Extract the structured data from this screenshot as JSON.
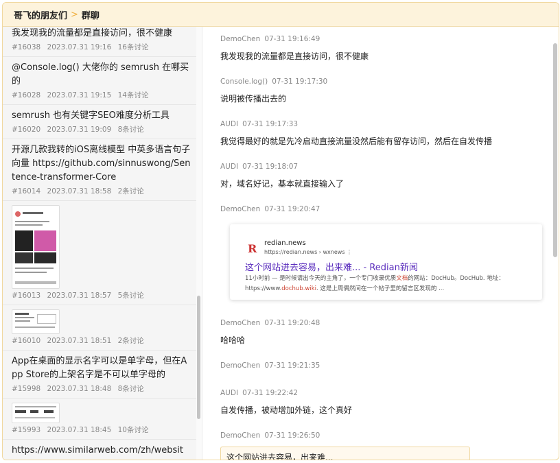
{
  "header": {
    "group": "哥飞的朋友们",
    "separator": ">",
    "current": "群聊"
  },
  "topics": [
    {
      "title": "我发现我的流量都是直接访问，很不健康",
      "id": "#16038",
      "time": "2023.07.31 19:16",
      "comments": "16条讨论"
    },
    {
      "title": "@Console.log() 大佬你的 semrush 在哪买的",
      "id": "#16028",
      "time": "2023.07.31 19:15",
      "comments": "14条讨论"
    },
    {
      "title": "semrush 也有关键字SEO难度分析工具",
      "id": "#16020",
      "time": "2023.07.31 19:09",
      "comments": "8条讨论"
    },
    {
      "title": "开源几款我转的iOS离线模型 中英多语言句子向量 https://github.com/sinnuswong/Sentence-transformer-Core",
      "id": "#16014",
      "time": "2023.07.31 18:58",
      "comments": "2条讨论"
    },
    {
      "title": "",
      "id": "#16013",
      "time": "2023.07.31 18:57",
      "comments": "5条讨论"
    },
    {
      "title": "",
      "id": "#16010",
      "time": "2023.07.31 18:51",
      "comments": "2条讨论"
    },
    {
      "title": "App在桌面的显示名字可以是单字母，但在App Store的上架名字是不可以单字母的",
      "id": "#15998",
      "time": "2023.07.31 18:48",
      "comments": "8条讨论"
    },
    {
      "title": "",
      "id": "#15993",
      "time": "2023.07.31 18:45",
      "comments": "10条讨论"
    },
    {
      "title": "https://www.similarweb.com/zh/website/w",
      "id": "",
      "time": "",
      "comments": ""
    }
  ],
  "messages": [
    {
      "user": "DemoChen",
      "time": "07-31 19:16:49",
      "text": "我发现我的流量都是直接访问，很不健康"
    },
    {
      "user": "Console.log()",
      "time": "07-31 19:17:30",
      "text": "说明被传播出去的"
    },
    {
      "user": "AUDI",
      "time": "07-31 19:17:33",
      "text": "我觉得最好的就是先冷启动直接流量没然后能有留存访问，然后在自发传播"
    },
    {
      "user": "AUDI",
      "time": "07-31 19:18:07",
      "text": "对，域名好记，基本就直接输入了"
    },
    {
      "user": "DemoChen",
      "time": "07-31 19:20:47",
      "text": ""
    },
    {
      "user": "DemoChen",
      "time": "07-31 19:20:48",
      "text": "哈哈哈"
    },
    {
      "user": "DemoChen",
      "time": "07-31 19:21:35",
      "text": ""
    },
    {
      "user": "AUDI",
      "time": "07-31 19:22:42",
      "text": "自发传播，被动增加外链，这个真好"
    },
    {
      "user": "DemoChen",
      "time": "07-31 19:26:50",
      "text": ""
    }
  ],
  "card": {
    "logo": "R",
    "site": "redian.news",
    "url": "https://redian.news › wxnews  ⋮",
    "title": "这个网站进去容易，出来难... - Redian新闻",
    "snippet_1": "11小时前 — 是时候请出今天的主角了，一个专门收录优质",
    "snippet_hl": "文档",
    "snippet_2": "的网站：DocHub。DocHub. 地址：https://www.",
    "snippet_hl2": "dochub.wiki",
    "snippet_3": ". 这是上周偶然间在一个帖子里的留言区发现的 ..."
  },
  "quote": {
    "text": "这个网站进去容易，出来难..."
  }
}
